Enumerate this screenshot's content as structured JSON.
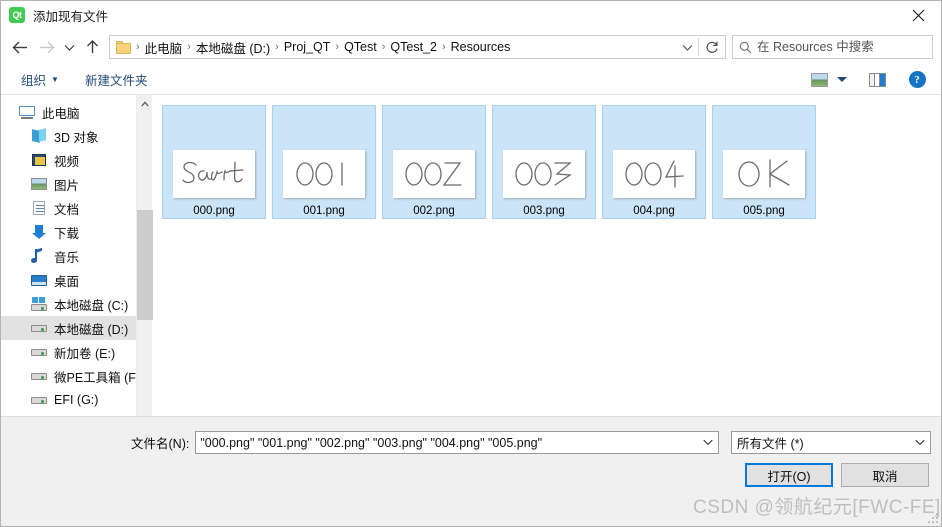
{
  "window": {
    "title": "添加现有文件",
    "app_icon": "qt-icon",
    "app_icon_text": "Qt",
    "close_label": "✕"
  },
  "nav": {
    "back": "←",
    "forward": "→",
    "recent_chevron": "⌄",
    "up": "↑",
    "refresh": "↻",
    "breadcrumb": [
      "此电脑",
      "本地磁盘 (D:)",
      "Proj_QT",
      "QTest",
      "QTest_2",
      "Resources"
    ],
    "separator": "›",
    "address_chevron": "⌄"
  },
  "search": {
    "placeholder": "在 Resources 中搜索",
    "value": "",
    "icon": "search-icon"
  },
  "toolbar": {
    "organize_label": "组织",
    "organize_caret": "▼",
    "new_folder_label": "新建文件夹",
    "view_caret": "▼",
    "help_glyph": "?"
  },
  "sidebar": {
    "items": [
      {
        "label": "此电脑",
        "icon": "computer-icon",
        "level": 0,
        "selected": false
      },
      {
        "label": "3D 对象",
        "icon": "3d-objects-icon",
        "level": 1,
        "selected": false
      },
      {
        "label": "视频",
        "icon": "videos-icon",
        "level": 1,
        "selected": false
      },
      {
        "label": "图片",
        "icon": "pictures-icon",
        "level": 1,
        "selected": false
      },
      {
        "label": "文档",
        "icon": "documents-icon",
        "level": 1,
        "selected": false
      },
      {
        "label": "下载",
        "icon": "downloads-icon",
        "level": 1,
        "selected": false
      },
      {
        "label": "音乐",
        "icon": "music-icon",
        "level": 1,
        "selected": false
      },
      {
        "label": "桌面",
        "icon": "desktop-icon",
        "level": 1,
        "selected": false
      },
      {
        "label": "本地磁盘 (C:)",
        "icon": "system-drive-icon",
        "level": 1,
        "selected": false
      },
      {
        "label": "本地磁盘 (D:)",
        "icon": "drive-icon",
        "level": 1,
        "selected": true
      },
      {
        "label": "新加卷 (E:)",
        "icon": "drive-icon",
        "level": 1,
        "selected": false
      },
      {
        "label": "微PE工具箱 (F:)",
        "icon": "drive-icon",
        "level": 1,
        "selected": false
      },
      {
        "label": "EFI (G:)",
        "icon": "drive-icon",
        "level": 1,
        "selected": false
      },
      {
        "label": "EFI (G:)",
        "icon": "drive-icon",
        "level": 0,
        "selected": false
      }
    ],
    "scroll_up": "⌃",
    "scroll_down": "⌄"
  },
  "files": [
    {
      "name": "000.png",
      "thumb_text": "Start",
      "selected": true
    },
    {
      "name": "001.png",
      "thumb_text": "001",
      "selected": true
    },
    {
      "name": "002.png",
      "thumb_text": "002",
      "selected": true
    },
    {
      "name": "003.png",
      "thumb_text": "003",
      "selected": true
    },
    {
      "name": "004.png",
      "thumb_text": "004",
      "selected": true
    },
    {
      "name": "005.png",
      "thumb_text": "OK",
      "selected": true
    }
  ],
  "footer": {
    "filename_label": "文件名(N):",
    "filename_value": "\"000.png\" \"001.png\" \"002.png\" \"003.png\" \"004.png\" \"005.png\"",
    "filename_placeholder": "",
    "filetype_value": "所有文件 (*)",
    "combo_chevron": "⌄",
    "open_button": "打开(O)",
    "cancel_button": "取消"
  },
  "watermark": "CSDN @领航纪元[FWC-FE]",
  "colors": {
    "accent": "#0078d7",
    "selection": "#cce4f7",
    "link": "#1f4a78",
    "qt_green": "#41cd52"
  }
}
